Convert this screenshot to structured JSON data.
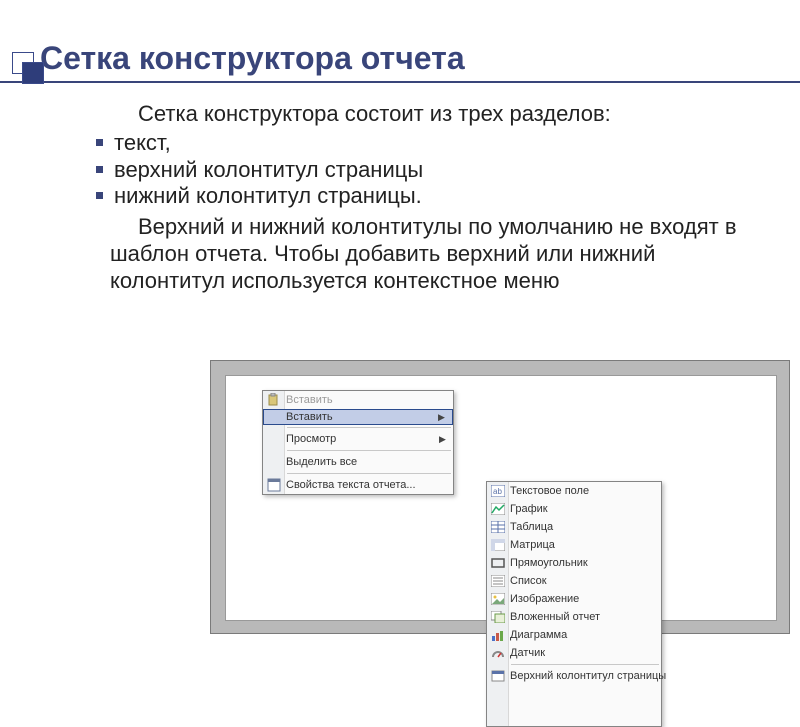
{
  "slide": {
    "title": "Сетка конструктора отчета",
    "intro": "Сетка конструктора состоит из трех разделов:",
    "bullets": [
      "текст,",
      "верхний колонтитул страницы",
      "нижний колонтитул страницы."
    ],
    "para": "Верхний и нижний колонтитулы по умолчанию не входят в шаблон отчета. Чтобы добавить верхний или нижний колонтитул используется контекстное меню"
  },
  "menu1": {
    "items": [
      {
        "label": "Вставить",
        "icon": "paste-icon",
        "disabled": true
      },
      {
        "label": "Вставить",
        "icon": null,
        "selected": true,
        "arrow": true
      }
    ],
    "view": "Просмотр",
    "select_all": "Выделить все",
    "props": "Свойства текста отчета...",
    "props_icon": "properties-icon"
  },
  "menu2": {
    "items": [
      {
        "label": "Текстовое поле",
        "icon": "textbox-icon"
      },
      {
        "label": "График",
        "icon": "chart-line-icon"
      },
      {
        "label": "Таблица",
        "icon": "table-icon"
      },
      {
        "label": "Матрица",
        "icon": "matrix-icon"
      },
      {
        "label": "Прямоугольник",
        "icon": "rectangle-icon"
      },
      {
        "label": "Список",
        "icon": "list-icon"
      },
      {
        "label": "Изображение",
        "icon": "image-icon"
      },
      {
        "label": "Вложенный отчет",
        "icon": "subreport-icon"
      },
      {
        "label": "Диаграмма",
        "icon": "chart-bar-icon"
      },
      {
        "label": "Датчик",
        "icon": "gauge-icon"
      }
    ],
    "footer": [
      {
        "label": "Верхний колонтитул страницы",
        "icon": "page-header-icon"
      }
    ]
  }
}
